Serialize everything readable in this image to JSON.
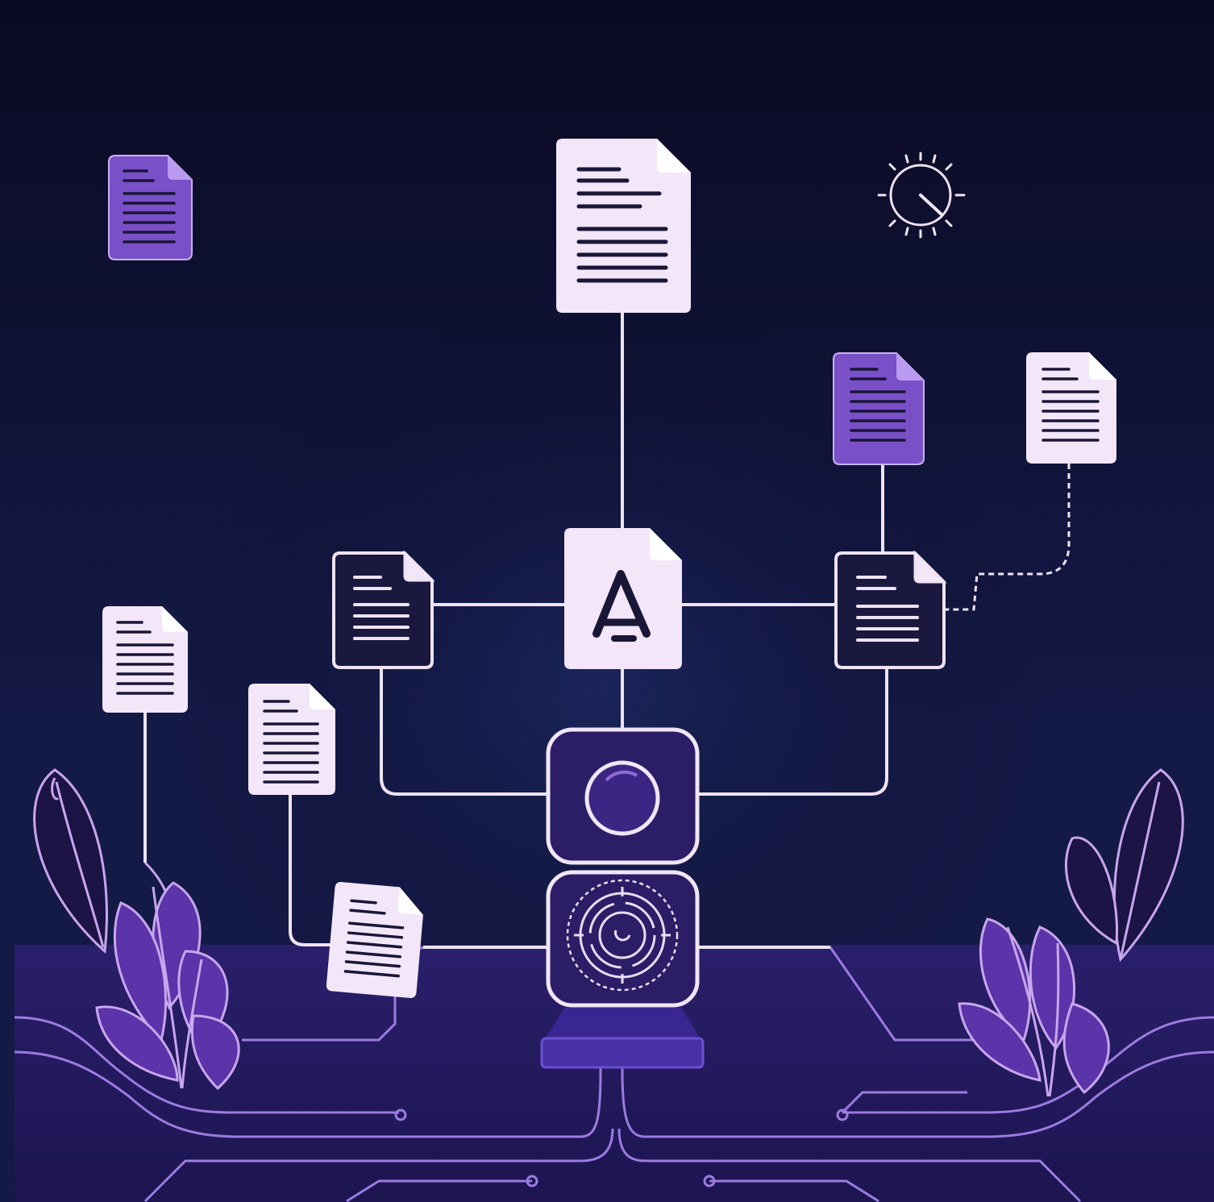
{
  "palette": {
    "background_top": "#0b0a24",
    "background_mid": "#141a46",
    "ground": "#2a1f6b",
    "document_light": "#f3e6f8",
    "document_purple": "#7a50c8",
    "document_dark": "#1b1840",
    "line_light": "#efe3f3",
    "circuit_purple": "#9c7be0",
    "leaf_outline": "#c9a6ee",
    "leaf_fill": "#5a34a8",
    "text_line_dark": "#1a1638"
  },
  "diagram": {
    "nodes": [
      {
        "id": "top-document",
        "kind": "document",
        "style": "light",
        "size": "large"
      },
      {
        "id": "center-hub",
        "kind": "document",
        "style": "light",
        "icon": "a-letter-icon"
      },
      {
        "id": "left-document",
        "kind": "document",
        "style": "dark"
      },
      {
        "id": "right-document",
        "kind": "document",
        "style": "dark"
      },
      {
        "id": "upper-right-purple-document",
        "kind": "document",
        "style": "purple"
      },
      {
        "id": "far-right-document",
        "kind": "document",
        "style": "light"
      },
      {
        "id": "far-left-document",
        "kind": "document",
        "style": "light"
      },
      {
        "id": "mid-left-document",
        "kind": "document",
        "style": "light"
      },
      {
        "id": "lower-tilted-document",
        "kind": "document",
        "style": "light"
      },
      {
        "id": "top-left-purple-document",
        "kind": "document",
        "style": "purple"
      },
      {
        "id": "camera-module",
        "kind": "device",
        "icon": "lens-icon"
      },
      {
        "id": "sensor-module",
        "kind": "device",
        "icon": "radar-icon"
      }
    ],
    "edges": [
      {
        "from": "top-document",
        "to": "center-hub",
        "style": "solid"
      },
      {
        "from": "left-document",
        "to": "center-hub",
        "style": "solid"
      },
      {
        "from": "center-hub",
        "to": "right-document",
        "style": "solid"
      },
      {
        "from": "upper-right-purple-document",
        "to": "right-document",
        "style": "solid"
      },
      {
        "from": "far-right-document",
        "to": "right-document",
        "style": "dashed"
      },
      {
        "from": "center-hub",
        "to": "camera-module",
        "style": "solid"
      },
      {
        "from": "left-document",
        "to": "camera-module",
        "style": "solid"
      },
      {
        "from": "right-document",
        "to": "camera-module",
        "style": "solid"
      },
      {
        "from": "mid-left-document",
        "to": "lower-tilted-document",
        "style": "solid"
      },
      {
        "from": "lower-tilted-document",
        "to": "sensor-module",
        "style": "solid"
      }
    ],
    "decorations": [
      "clock-icon",
      "plant-left",
      "plant-right",
      "circuit-traces"
    ]
  }
}
